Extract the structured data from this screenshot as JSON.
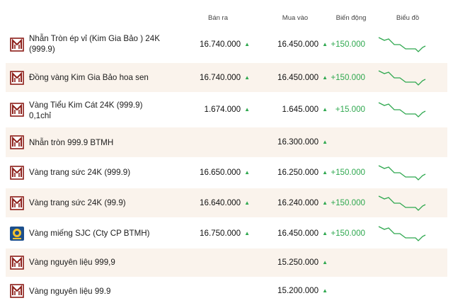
{
  "columns": {
    "sell": "Bán ra",
    "buy": "Mua vào",
    "change": "Biến động",
    "chart": "Biểu đồ"
  },
  "colors": {
    "up": "#2fa84f",
    "brand_red": "#8c1d18",
    "row_alt": "#faf3ec"
  },
  "rows": [
    {
      "name": "Nhẫn Tròn ép vỉ (Kim Gia Bảo ) 24K (999.9)",
      "sell": "16.740.000",
      "buy": "16.450.000",
      "change": "+150.000",
      "logo": "btmh-logo-icon",
      "sell_arrow": "▲",
      "buy_arrow": "▲"
    },
    {
      "name": "Đồng vàng Kim Gia Bảo hoa sen",
      "sell": "16.740.000",
      "buy": "16.450.000",
      "change": "+150.000",
      "logo": "btmh-logo-icon",
      "sell_arrow": "▲",
      "buy_arrow": "▲"
    },
    {
      "name": "Vàng Tiểu Kim Cát 24K (999.9) 0,1chỉ",
      "sell": "1.674.000",
      "buy": "1.645.000",
      "change": "+15.000",
      "logo": "btmh-logo-icon",
      "sell_arrow": "▲",
      "buy_arrow": "▲"
    },
    {
      "name": "Nhẫn tròn 999.9 BTMH",
      "sell": "",
      "buy": "16.300.000",
      "change": "",
      "logo": "btmh-logo-icon",
      "sell_arrow": "",
      "buy_arrow": "▲"
    },
    {
      "name": "Vàng trang sức 24K (999.9)",
      "sell": "16.650.000",
      "buy": "16.250.000",
      "change": "+150.000",
      "logo": "btmh-logo-icon",
      "sell_arrow": "▲",
      "buy_arrow": "▲"
    },
    {
      "name": "Vàng trang sức 24K (99.9)",
      "sell": "16.640.000",
      "buy": "16.240.000",
      "change": "+150.000",
      "logo": "btmh-logo-icon",
      "sell_arrow": "▲",
      "buy_arrow": "▲"
    },
    {
      "name": "Vàng miếng SJC (Cty CP BTMH)",
      "sell": "16.750.000",
      "buy": "16.450.000",
      "change": "+150.000",
      "logo": "sjc-logo-icon",
      "sell_arrow": "▲",
      "buy_arrow": "▲"
    },
    {
      "name": "Vàng nguyên liệu 999,9",
      "sell": "",
      "buy": "15.250.000",
      "change": "",
      "logo": "btmh-logo-icon",
      "sell_arrow": "",
      "buy_arrow": "▲"
    },
    {
      "name": "Vàng nguyên liệu 99.9",
      "sell": "",
      "buy": "15.200.000",
      "change": "",
      "logo": "btmh-logo-icon",
      "sell_arrow": "",
      "buy_arrow": "▲"
    }
  ]
}
